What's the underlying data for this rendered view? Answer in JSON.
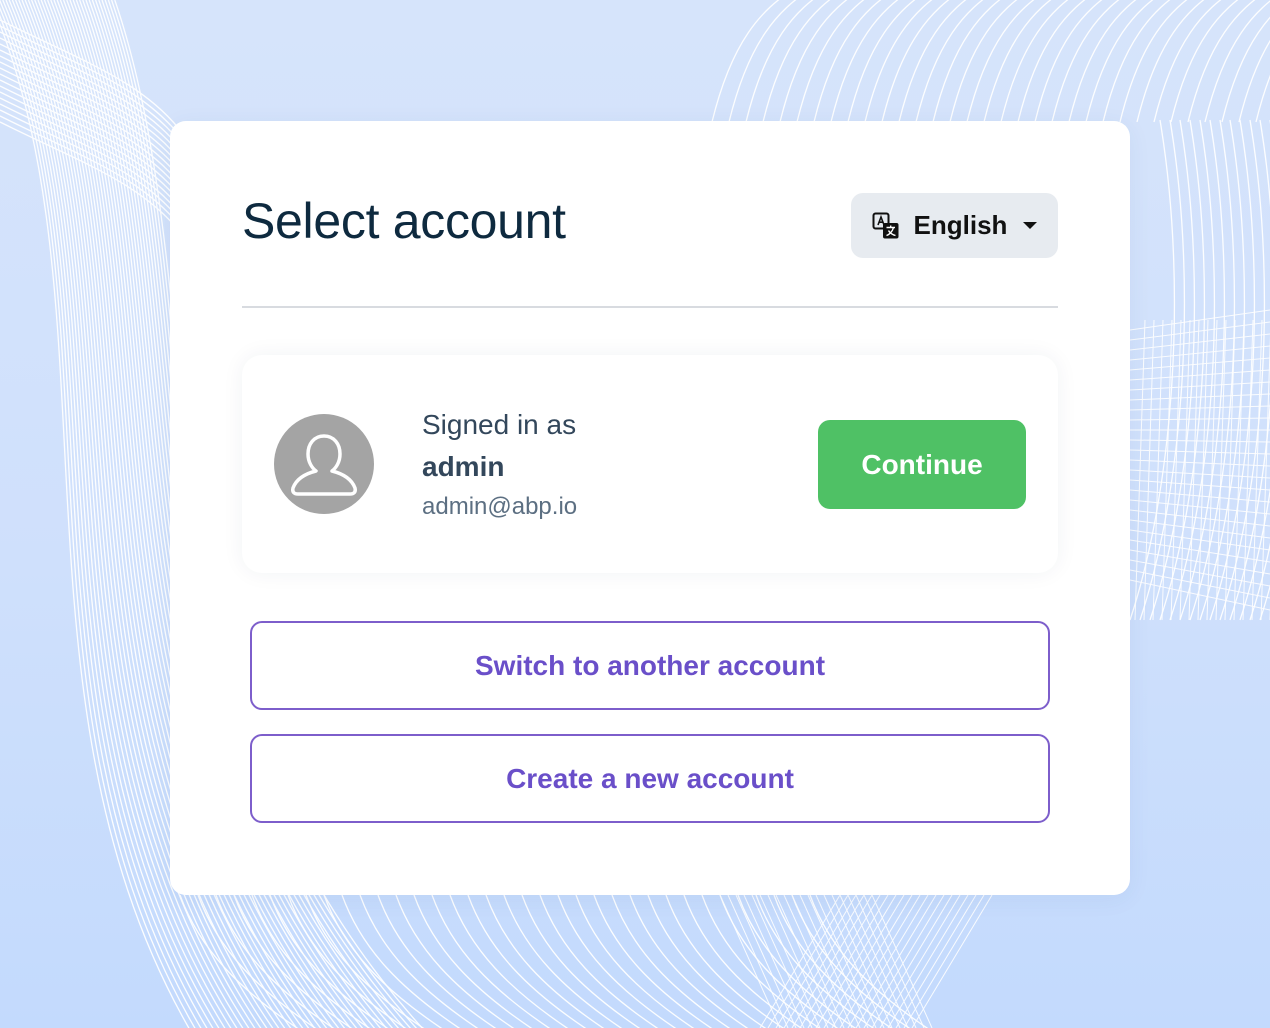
{
  "page": {
    "title": "Select account"
  },
  "language": {
    "label": "English",
    "icon": "translate-icon"
  },
  "account": {
    "signed_in_label": "Signed in as",
    "username": "admin",
    "email": "admin@abp.io",
    "avatar_icon": "user-icon",
    "continue_label": "Continue"
  },
  "actions": {
    "switch_label": "Switch to another account",
    "create_label": "Create a new account"
  },
  "colors": {
    "background": "#d6e4fb",
    "continue": "#4fc165",
    "accent": "#6a4fc9",
    "title": "#0e2a3f"
  }
}
